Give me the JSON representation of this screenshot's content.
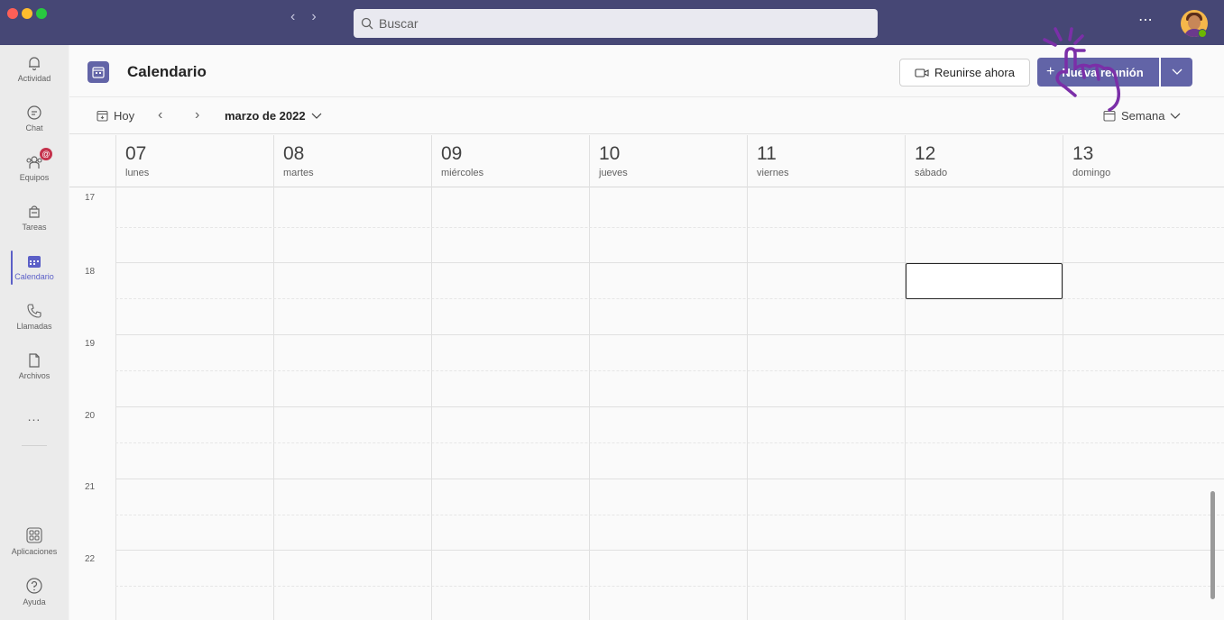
{
  "titlebar": {
    "search_placeholder": "Buscar"
  },
  "rail": {
    "items": [
      {
        "label": "Actividad",
        "icon": "bell-icon"
      },
      {
        "label": "Chat",
        "icon": "chat-icon"
      },
      {
        "label": "Equipos",
        "icon": "teams-icon",
        "badge": "@"
      },
      {
        "label": "Tareas",
        "icon": "tasks-icon"
      },
      {
        "label": "Calendario",
        "icon": "calendar-icon",
        "active": true
      },
      {
        "label": "Llamadas",
        "icon": "phone-icon"
      },
      {
        "label": "Archivos",
        "icon": "file-icon"
      },
      {
        "label": "...",
        "icon": "more-icon"
      },
      {
        "label": "Aplicaciones",
        "icon": "apps-icon"
      },
      {
        "label": "Ayuda",
        "icon": "help-icon"
      }
    ]
  },
  "header": {
    "title": "Calendario",
    "meet_now_label": "Reunirse ahora",
    "new_meeting_label": "Nueva reunión"
  },
  "toolbar": {
    "today_label": "Hoy",
    "month_label": "marzo de 2022",
    "view_label": "Semana"
  },
  "days": [
    {
      "num": "07",
      "name": "lunes"
    },
    {
      "num": "08",
      "name": "martes"
    },
    {
      "num": "09",
      "name": "miércoles"
    },
    {
      "num": "10",
      "name": "jueves"
    },
    {
      "num": "11",
      "name": "viernes"
    },
    {
      "num": "12",
      "name": "sábado"
    },
    {
      "num": "13",
      "name": "domingo"
    }
  ],
  "hours": [
    "17",
    "18",
    "19",
    "20",
    "21",
    "22"
  ],
  "colors": {
    "titlebar": "#464775",
    "accent": "#6264a7",
    "annotation": "#7b2fa8"
  }
}
